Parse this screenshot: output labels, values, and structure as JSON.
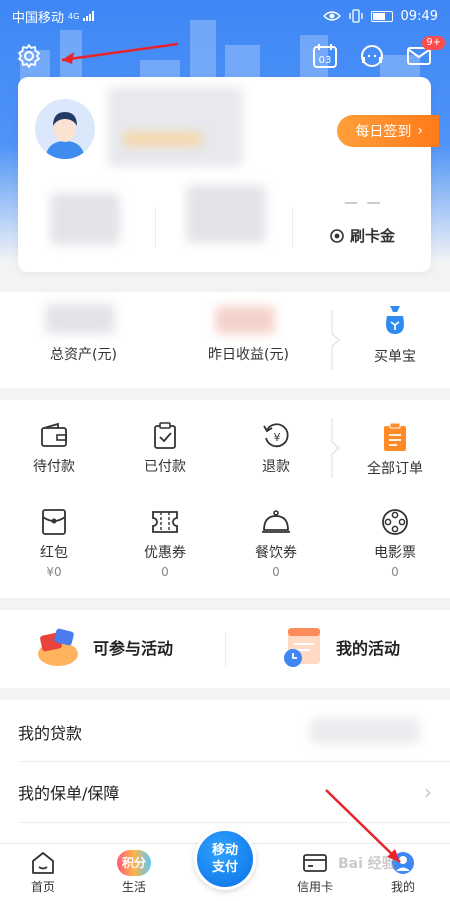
{
  "status_bar": {
    "carrier": "中国移动",
    "network": "4G",
    "time": "09:49"
  },
  "header": {
    "calendar_day": "03",
    "message_badge": "9+"
  },
  "profile": {
    "checkin_label": "每日签到",
    "gold_dash": "— —",
    "gold_label": "刷卡金"
  },
  "assets": {
    "total_label": "总资产(元)",
    "yesterday_label": "昨日收益(元)",
    "maidanbao_label": "买单宝"
  },
  "orders": {
    "pending_pay": "待付款",
    "paid": "已付款",
    "refund": "退款",
    "all_orders": "全部订单",
    "red_packet": "红包",
    "red_packet_value": "¥0",
    "coupon": "优惠券",
    "coupon_value": "0",
    "meal_voucher": "餐饮券",
    "meal_voucher_value": "0",
    "movie_ticket": "电影票",
    "movie_ticket_value": "0"
  },
  "activities": {
    "join": "可参与活动",
    "mine": "我的活动"
  },
  "list": {
    "loans": "我的贷款",
    "policies": "我的保单/保障"
  },
  "nav": {
    "home": "首页",
    "life": "生活",
    "life_badge": "积分",
    "pay_line1": "移动",
    "pay_line2": "支付",
    "credit_card": "信用卡",
    "mine": "我的"
  },
  "watermark": "Bai 经验",
  "colors": {
    "brand_blue": "#3f87f5",
    "checkin_orange": "#ff8a26",
    "badge_red": "#ff4d4f"
  }
}
